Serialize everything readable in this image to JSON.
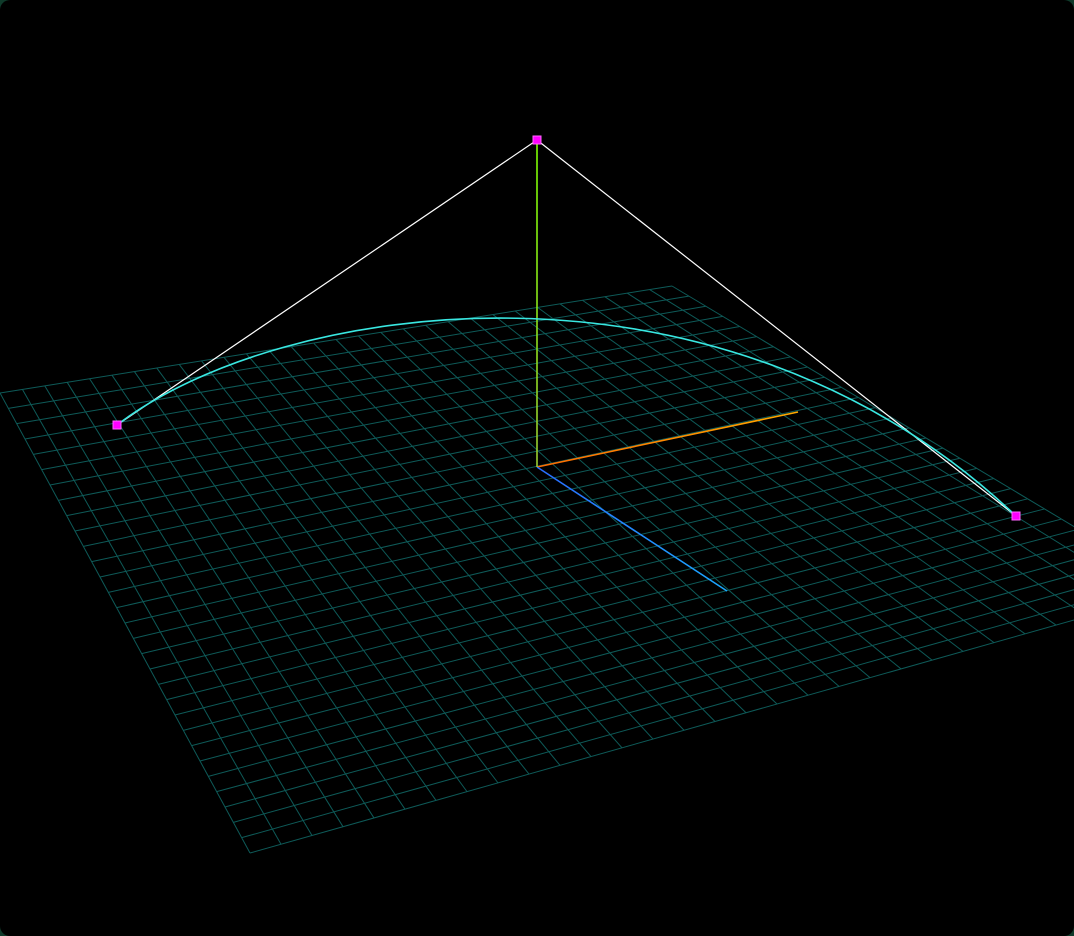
{
  "viewport": {
    "background": "#000000",
    "frame_color": "#0f3a2a"
  },
  "scene": {
    "type": "3d-bezier-curve-editor",
    "grid": {
      "visible": true,
      "divisions": 30,
      "color": "#0e5a58"
    },
    "axes": {
      "x_color": "#ff6a00",
      "x_end_color": "#ffaa00",
      "y_color": "#9acd32",
      "y_end_color": "#7cff00",
      "z_color": "#2a6cff",
      "z_end_color": "#1aa8ff"
    },
    "control_polygon": {
      "color": "#ffffff",
      "point_color": "#ff00ff",
      "point_count": 3
    },
    "curve": {
      "type": "quadratic-bezier",
      "color": "#39e7e1"
    }
  }
}
